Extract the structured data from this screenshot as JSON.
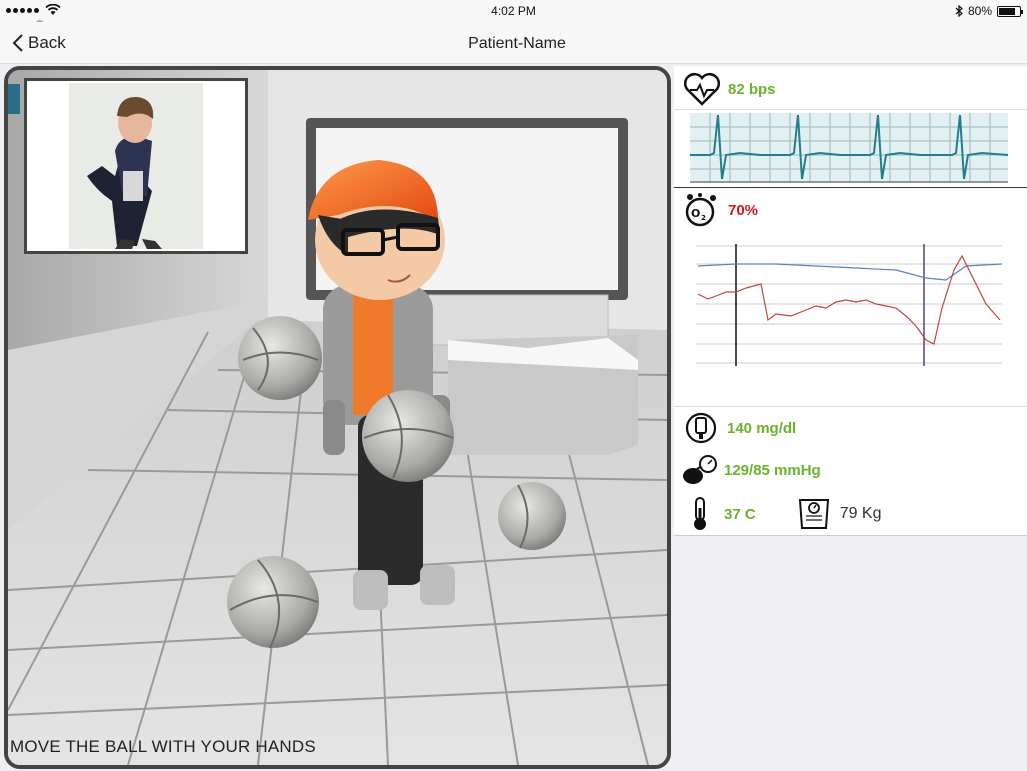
{
  "status_bar": {
    "time": "4:02 PM",
    "battery": "80%",
    "battery_level": 0.8
  },
  "nav": {
    "back_label": "Back",
    "title": "Patient-Name"
  },
  "game": {
    "instruction": "MOVE THE BALL WITH YOUR HANDS"
  },
  "vitals": {
    "heart_rate": "82 bps",
    "oxygen": "70%",
    "glucose": "140 mg/dl",
    "blood_pressure": "129/85 mmHg",
    "temperature": "37 C",
    "weight": "79 Kg"
  },
  "colors": {
    "good": "#6bb32e",
    "alert": "#d21a1a",
    "ecg_line": "#2a8a9a",
    "ecg_bg": "#e2f0f2"
  },
  "icons": [
    "heart-pulse-icon",
    "oxygen-icon",
    "glucose-meter-icon",
    "blood-pressure-icon",
    "thermometer-icon",
    "scale-icon"
  ]
}
